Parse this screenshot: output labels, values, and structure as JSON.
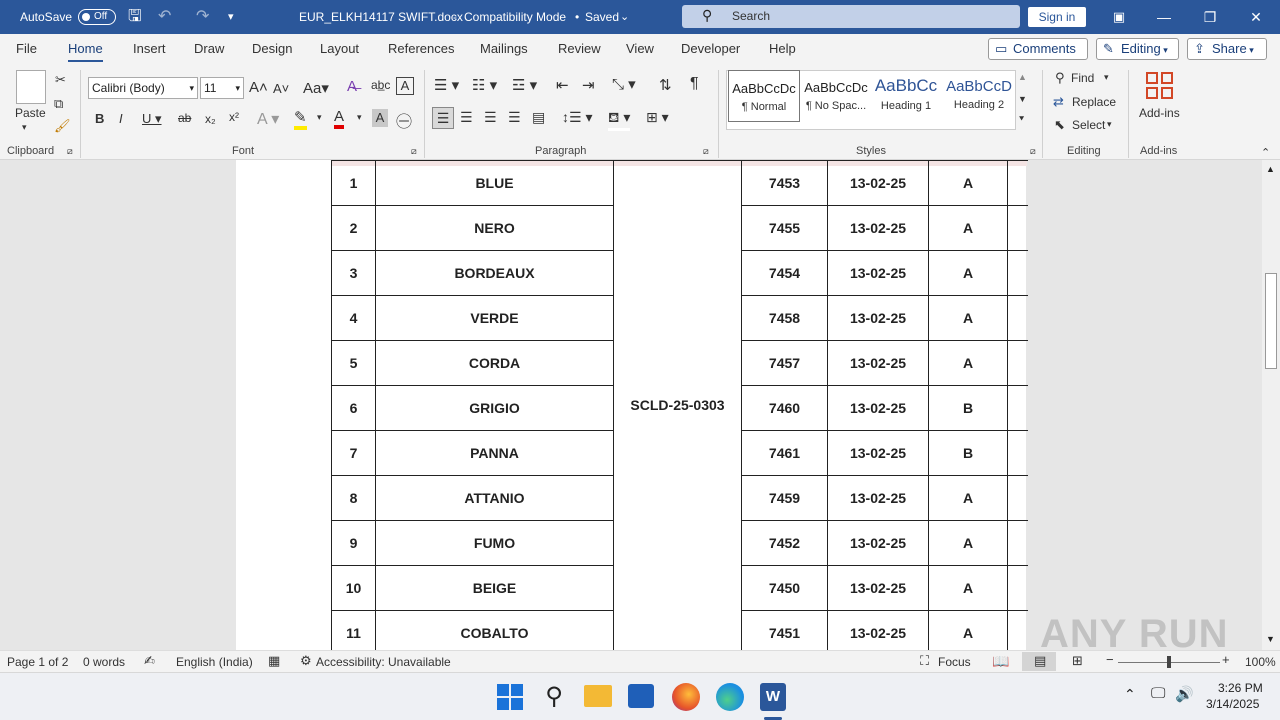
{
  "titlebar": {
    "autosave_label": "AutoSave",
    "autosave_state": "Off",
    "doc_title": "EUR_ELKH14117 SWIFT.docx",
    "mode": "Compatibility Mode",
    "saved": "Saved",
    "search_placeholder": "Search",
    "signin": "Sign in"
  },
  "tabs": [
    "File",
    "Home",
    "Insert",
    "Draw",
    "Design",
    "Layout",
    "References",
    "Mailings",
    "Review",
    "View",
    "Developer",
    "Help"
  ],
  "tab_actions": {
    "comments": "Comments",
    "editing": "Editing",
    "share": "Share"
  },
  "ribbon": {
    "clipboard": {
      "paste": "Paste",
      "label": "Clipboard"
    },
    "font": {
      "name": "Calibri (Body)",
      "size": "11",
      "label": "Font"
    },
    "paragraph": {
      "label": "Paragraph"
    },
    "styles": {
      "label": "Styles",
      "items": [
        {
          "sample": "AaBbCcDc",
          "name": "¶ Normal"
        },
        {
          "sample": "AaBbCcDc",
          "name": "¶ No Spac..."
        },
        {
          "sample": "AaBbCc",
          "name": "Heading 1"
        },
        {
          "sample": "AaBbCcD",
          "name": "Heading 2"
        }
      ]
    },
    "editing": {
      "find": "Find",
      "replace": "Replace",
      "select": "Select",
      "label": "Editing"
    },
    "addins": {
      "button": "Add-ins",
      "label": "Add-ins"
    }
  },
  "table": {
    "merged_code": "SCLD-25-0303",
    "rows": [
      {
        "n": "1",
        "color": "BLUE",
        "num": "7453",
        "date": "13-02-25",
        "grade": "A"
      },
      {
        "n": "2",
        "color": "NERO",
        "num": "7455",
        "date": "13-02-25",
        "grade": "A"
      },
      {
        "n": "3",
        "color": "BORDEAUX",
        "num": "7454",
        "date": "13-02-25",
        "grade": "A"
      },
      {
        "n": "4",
        "color": "VERDE",
        "num": "7458",
        "date": "13-02-25",
        "grade": "A"
      },
      {
        "n": "5",
        "color": "CORDA",
        "num": "7457",
        "date": "13-02-25",
        "grade": "A"
      },
      {
        "n": "6",
        "color": "GRIGIO",
        "num": "7460",
        "date": "13-02-25",
        "grade": "B"
      },
      {
        "n": "7",
        "color": "PANNA",
        "num": "7461",
        "date": "13-02-25",
        "grade": "B"
      },
      {
        "n": "8",
        "color": "ATTANIO",
        "num": "7459",
        "date": "13-02-25",
        "grade": "A"
      },
      {
        "n": "9",
        "color": "FUMO",
        "num": "7452",
        "date": "13-02-25",
        "grade": "A"
      },
      {
        "n": "10",
        "color": "BEIGE",
        "num": "7450",
        "date": "13-02-25",
        "grade": "A"
      },
      {
        "n": "11",
        "color": "COBALTO",
        "num": "7451",
        "date": "13-02-25",
        "grade": "A"
      }
    ]
  },
  "status": {
    "page": "Page 1 of 2",
    "words": "0 words",
    "language": "English (India)",
    "accessibility": "Accessibility: Unavailable",
    "focus": "Focus",
    "zoom": "100%"
  },
  "taskbar": {
    "time": "3:26 PM",
    "date": "3/14/2025"
  },
  "watermark": "ANY RUN"
}
